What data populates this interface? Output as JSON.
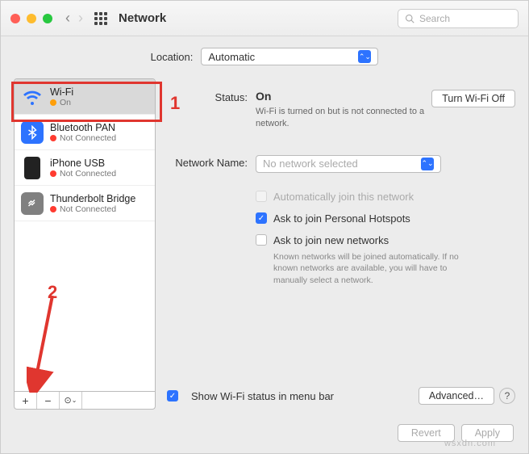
{
  "titlebar": {
    "title": "Network",
    "search_placeholder": "Search"
  },
  "location": {
    "label": "Location:",
    "value": "Automatic"
  },
  "sidebar": {
    "items": [
      {
        "name": "Wi-Fi",
        "status": "On",
        "dot": "orange",
        "selected": true
      },
      {
        "name": "Bluetooth PAN",
        "status": "Not Connected",
        "dot": "red"
      },
      {
        "name": "iPhone USB",
        "status": "Not Connected",
        "dot": "red"
      },
      {
        "name": "Thunderbolt Bridge",
        "status": "Not Connected",
        "dot": "red"
      }
    ],
    "add": "+",
    "remove": "−",
    "more": "⊙"
  },
  "detail": {
    "status_label": "Status:",
    "status_value": "On",
    "turn_off": "Turn Wi-Fi Off",
    "status_desc": "Wi-Fi is turned on but is not connected to a network.",
    "network_label": "Network Name:",
    "network_value": "No network selected",
    "check_auto_join": "Automatically join this network",
    "check_hotspots": "Ask to join Personal Hotspots",
    "check_new": "Ask to join new networks",
    "check_new_desc": "Known networks will be joined automatically. If no known networks are available, you will have to manually select a network.",
    "show_menubar": "Show Wi-Fi status in menu bar",
    "advanced": "Advanced…",
    "help": "?"
  },
  "footer": {
    "revert": "Revert",
    "apply": "Apply"
  },
  "annotations": {
    "num1": "1",
    "num2": "2"
  },
  "watermark": "wsxdn.com"
}
